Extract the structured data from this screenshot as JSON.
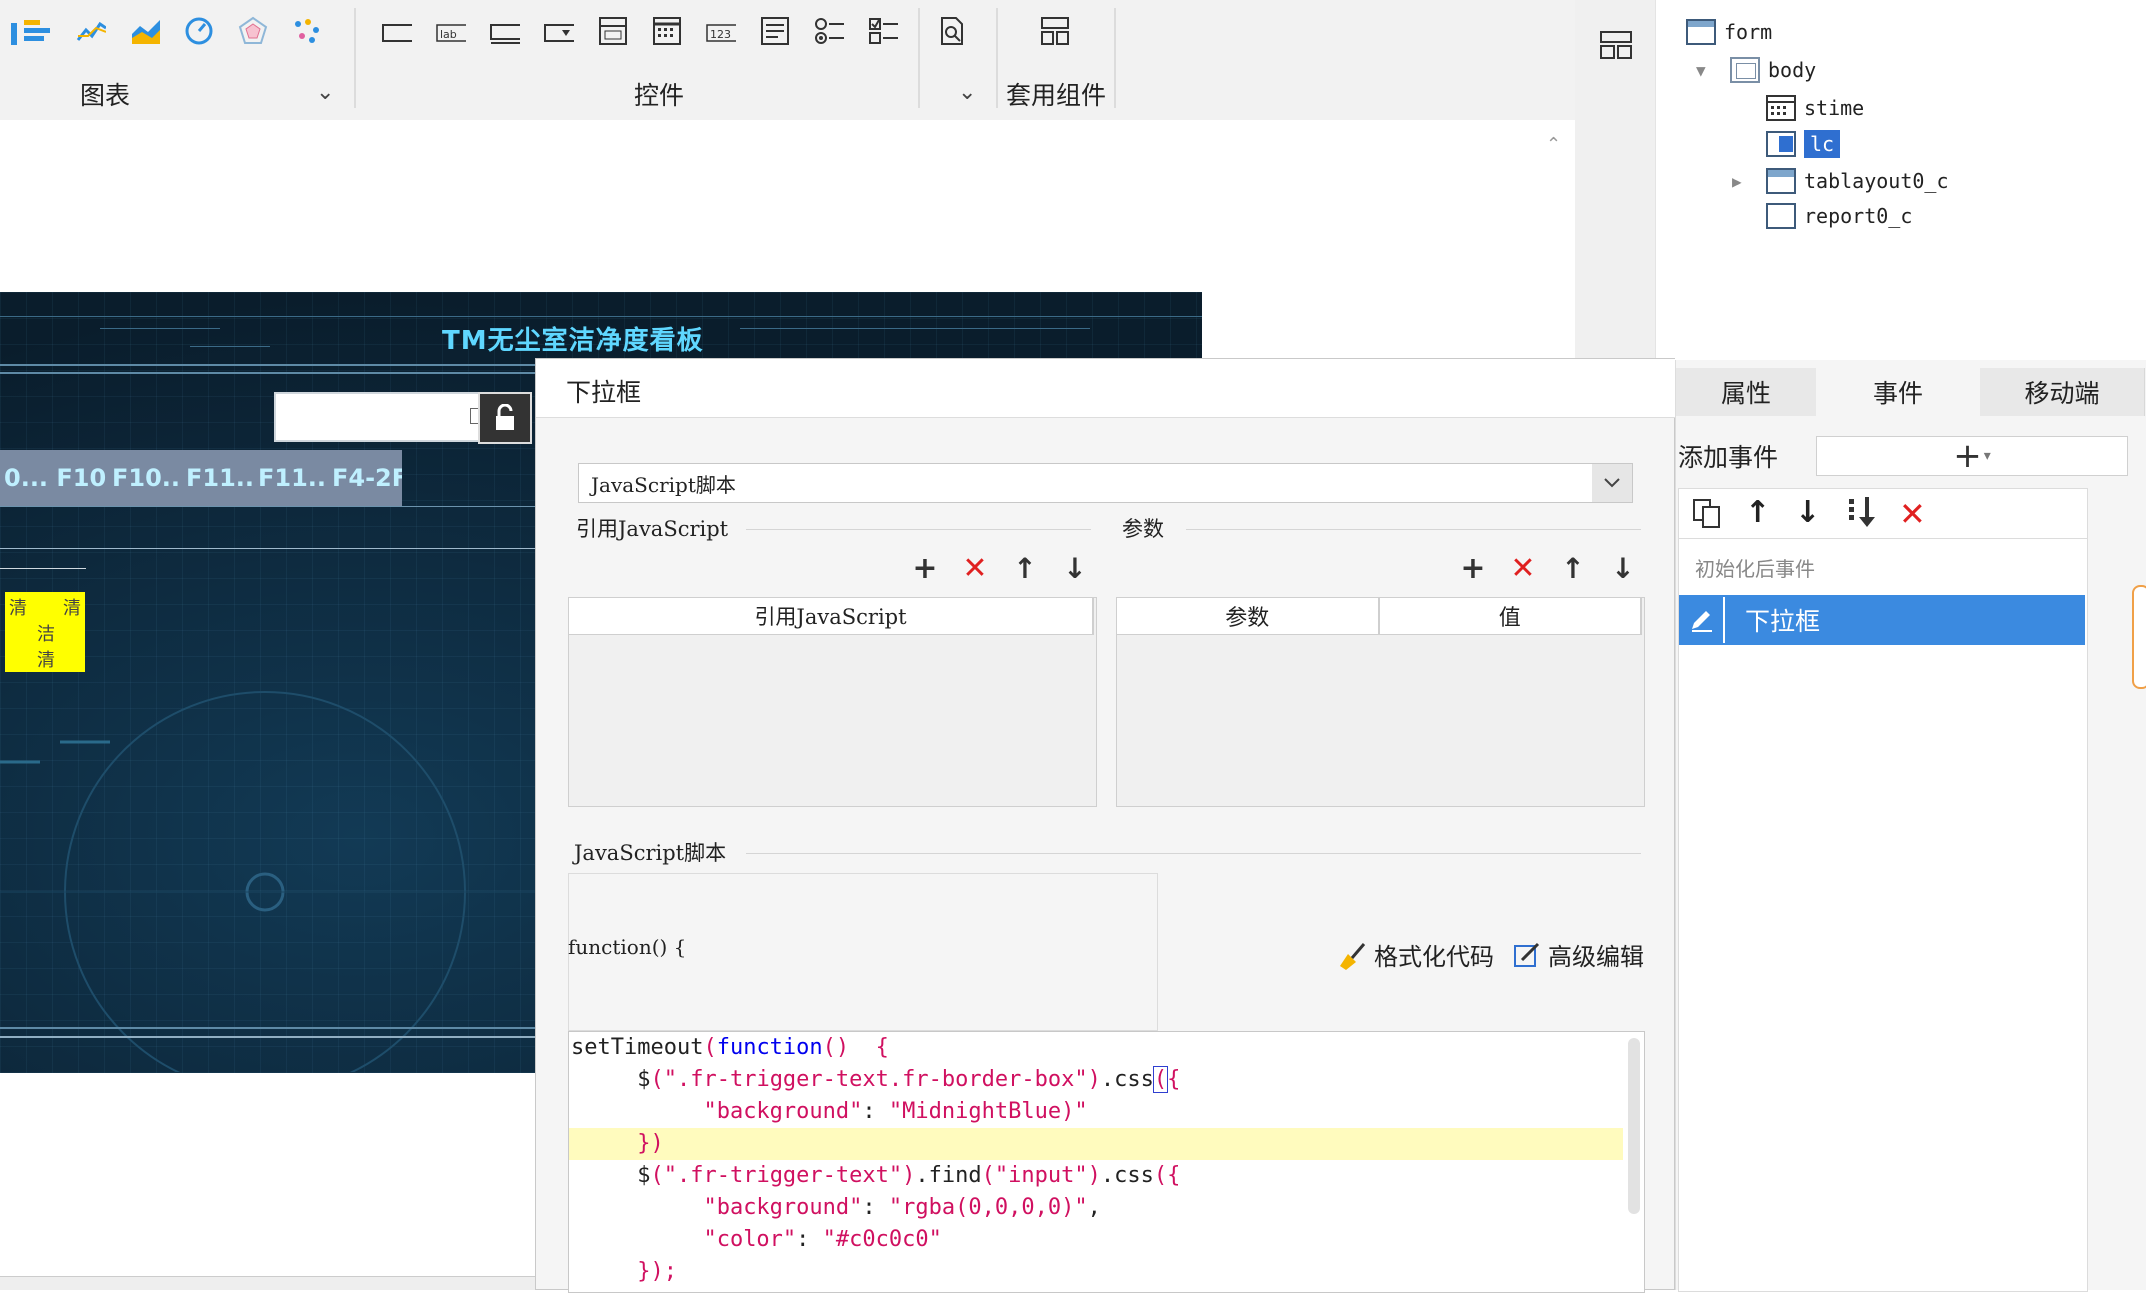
{
  "toolbar": {
    "groups": {
      "chart": "图表",
      "controls": "控件",
      "applied_components": "套用组件"
    }
  },
  "dashboard": {
    "title": "TM无尘室洁净度看板",
    "tabs": [
      "0... F10...",
      "F10...",
      "F11...",
      "F11...",
      "F4-2F"
    ],
    "yellow_cells": [
      "清",
      "清",
      "洁",
      "清"
    ]
  },
  "tree": {
    "items": [
      {
        "label": "form"
      },
      {
        "label": "body"
      },
      {
        "label": "stime"
      },
      {
        "label": "lc"
      },
      {
        "label": "tablayout0_c"
      },
      {
        "label": "report0_c"
      }
    ]
  },
  "dialog": {
    "title": "下拉框",
    "script_type": "JavaScript脚本",
    "ref_section": "引用JavaScript",
    "param_section": "参数",
    "ref_col": "引用JavaScript",
    "param_col": "参数",
    "value_col": "值",
    "script_section": "JavaScript脚本",
    "function_sig": "function() {",
    "format_code": "格式化代码",
    "advanced_edit": "高级编辑"
  },
  "code_lines": [
    {
      "t": "setTimeout(function()  {"
    },
    {
      "t": "     $(\".fr-trigger-text.fr-border-box\").css({"
    },
    {
      "t": "          \"background\": \"MidnightBlue)\""
    },
    {
      "t": "     })"
    },
    {
      "t": "     $(\".fr-trigger-text\").find(\"input\").css({"
    },
    {
      "t": "          \"background\": \"rgba(0,0,0,0)\","
    },
    {
      "t": "          \"color\": \"#c0c0c0\""
    },
    {
      "t": "     });"
    }
  ],
  "event_panel": {
    "tabs": [
      "属性",
      "事件",
      "移动端"
    ],
    "add_event": "添加事件",
    "group": "初始化后事件",
    "selected_event": "下拉框"
  },
  "colors": {
    "accent": "#3b8ae0",
    "delete": "#e02020",
    "highlight": "#fffbbe",
    "dash_title": "#5fd7ff"
  }
}
